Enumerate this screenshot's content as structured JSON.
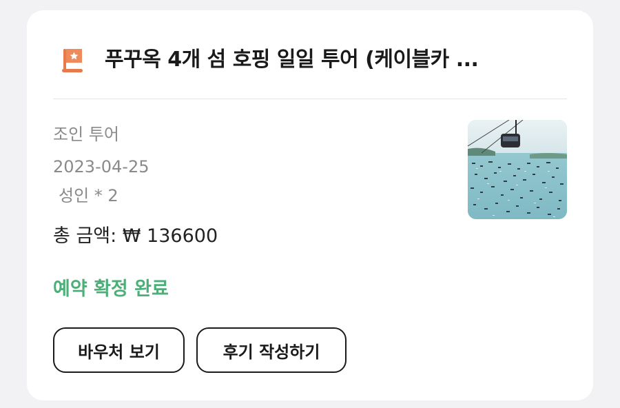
{
  "booking": {
    "title": "푸꾸옥 4개 섬 호핑 일일 투어 (케이블카 ...",
    "title_icon": "flag-icon",
    "tour_type": "조인 투어",
    "date": "2023-04-25",
    "people": "성인 * 2",
    "total": "총 금액: ₩ 136600",
    "status": "예약 확정 완료",
    "status_color": "#4caf78",
    "thumbnail": "cable-car-over-bay-photo"
  },
  "actions": {
    "voucher_label": "바우처 보기",
    "review_label": "후기 작성하기"
  }
}
